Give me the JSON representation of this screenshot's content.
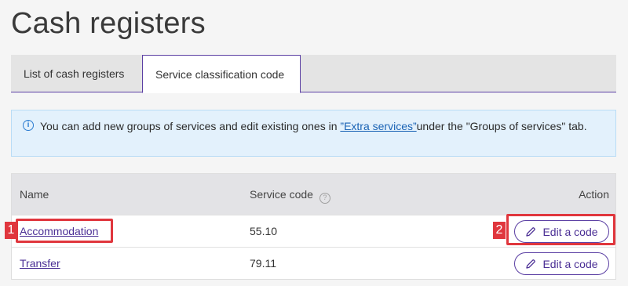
{
  "page": {
    "title": "Cash registers"
  },
  "tabs": [
    {
      "label": "List of cash registers",
      "active": false
    },
    {
      "label": "Service classification code",
      "active": true
    }
  ],
  "info": {
    "icon": "info-icon",
    "text_before": "You can add new groups of services and edit existing ones in ",
    "link_text": "”Extra services”",
    "text_after": "under the \"Groups of services\" tab."
  },
  "table": {
    "headers": {
      "name": "Name",
      "code": "Service code",
      "action": "Action",
      "help_icon": "question-icon"
    },
    "rows": [
      {
        "name": "Accommodation",
        "code": "55.10",
        "action_label": "Edit a code"
      },
      {
        "name": "Transfer",
        "code": "79.11",
        "action_label": "Edit a code"
      }
    ]
  },
  "callouts": [
    {
      "number": "1",
      "target": "Accommodation"
    },
    {
      "number": "2",
      "target": "Edit a code"
    }
  ],
  "colors": {
    "accent": "#5b3fa3",
    "callout": "#e0363d",
    "info_bg": "#e3f1fc"
  }
}
